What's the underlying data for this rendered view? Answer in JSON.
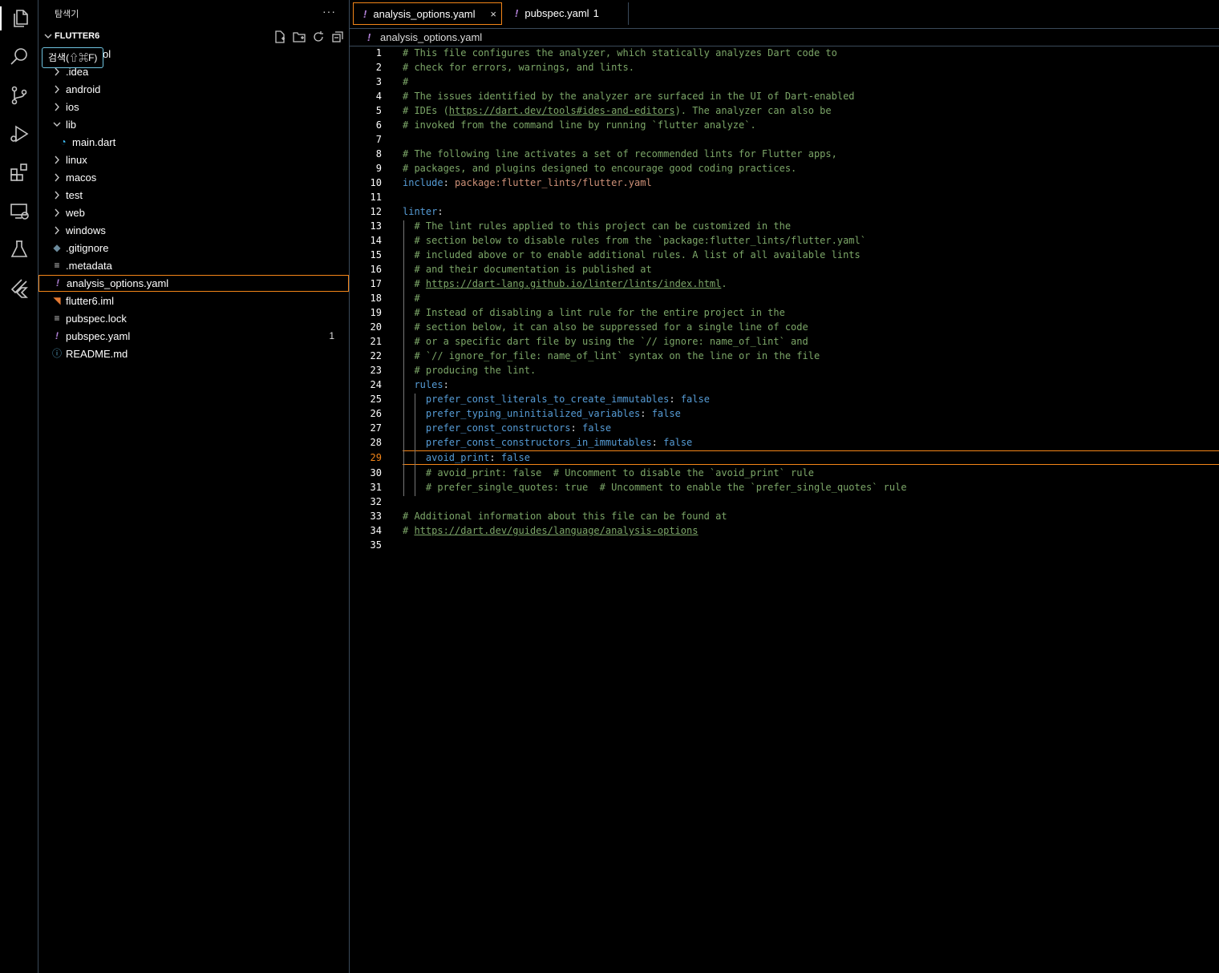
{
  "tooltip": "검색(⇧⌘F)",
  "sidebar": {
    "title": "탐색기",
    "more": "···",
    "project": "FLUTTER6",
    "items": [
      {
        "label": "ol",
        "type": "folder",
        "indent": 0
      },
      {
        "label": ".idea",
        "type": "folder"
      },
      {
        "label": "android",
        "type": "folder"
      },
      {
        "label": "ios",
        "type": "folder"
      },
      {
        "label": "lib",
        "type": "folder-open"
      },
      {
        "label": "main.dart",
        "type": "dart-file"
      },
      {
        "label": "linux",
        "type": "folder"
      },
      {
        "label": "macos",
        "type": "folder"
      },
      {
        "label": "test",
        "type": "folder"
      },
      {
        "label": "web",
        "type": "folder"
      },
      {
        "label": "windows",
        "type": "folder"
      },
      {
        "label": ".gitignore",
        "type": "git-file"
      },
      {
        "label": ".metadata",
        "type": "text-file"
      },
      {
        "label": "analysis_options.yaml",
        "type": "yaml-file",
        "selected": true
      },
      {
        "label": "flutter6.iml",
        "type": "xml-file"
      },
      {
        "label": "pubspec.lock",
        "type": "text-file"
      },
      {
        "label": "pubspec.yaml",
        "type": "yaml-file",
        "badge": "1"
      },
      {
        "label": "README.md",
        "type": "info-file"
      }
    ]
  },
  "tabs": [
    {
      "label": "analysis_options.yaml",
      "close": "×"
    },
    {
      "label": "pubspec.yaml",
      "badge": "1"
    }
  ],
  "breadcrumb": "analysis_options.yaml",
  "editor": {
    "current_line": 29,
    "lines": [
      "# This file configures the analyzer, which statically analyzes Dart code to",
      "# check for errors, warnings, and lints.",
      "#",
      "# The issues identified by the analyzer are surfaced in the UI of Dart-enabled",
      "# IDEs (https://dart.dev/tools#ides-and-editors). The analyzer can also be",
      "# invoked from the command line by running `flutter analyze`.",
      "",
      "# The following line activates a set of recommended lints for Flutter apps,",
      "# packages, and plugins designed to encourage good coding practices.",
      "include: package:flutter_lints/flutter.yaml",
      "",
      "linter:",
      "  # The lint rules applied to this project can be customized in the",
      "  # section below to disable rules from the `package:flutter_lints/flutter.yaml`",
      "  # included above or to enable additional rules. A list of all available lints",
      "  # and their documentation is published at",
      "  # https://dart-lang.github.io/linter/lints/index.html.",
      "  #",
      "  # Instead of disabling a lint rule for the entire project in the",
      "  # section below, it can also be suppressed for a single line of code",
      "  # or a specific dart file by using the `// ignore: name_of_lint` and",
      "  # `// ignore_for_file: name_of_lint` syntax on the line or in the file",
      "  # producing the lint.",
      "  rules:",
      "    prefer_const_literals_to_create_immutables: false",
      "    prefer_typing_uninitialized_variables: false",
      "    prefer_const_constructors: false",
      "    prefer_const_constructors_in_immutables: false",
      "    avoid_print: false",
      "    # avoid_print: false  # Uncomment to disable the `avoid_print` rule",
      "    # prefer_single_quotes: true  # Uncomment to enable the `prefer_single_quotes` rule",
      "",
      "# Additional information about this file can be found at",
      "# https://dart.dev/guides/language/analysis-options",
      ""
    ]
  },
  "colors": {
    "comment": "#7ca668",
    "key": "#569cd6",
    "string": "#ce9178",
    "focus_border": "#f38518",
    "tooltip_border": "#6fc3df"
  }
}
